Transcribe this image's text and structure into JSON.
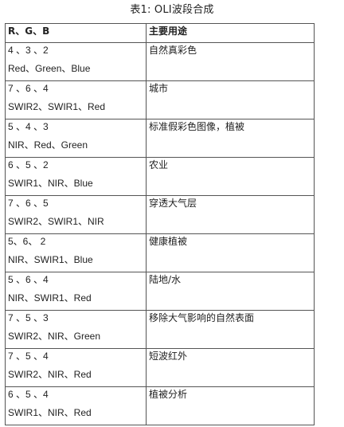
{
  "caption": "表1: OLI波段合成",
  "table": {
    "headers": [
      "R、G、B",
      "主要用途"
    ],
    "rows": [
      {
        "bands": "4 、3 、2",
        "names": "Red、Green、Blue",
        "use": "自然真彩色"
      },
      {
        "bands": "7 、6 、4",
        "names": "SWIR2、SWIR1、Red",
        "use": "城市"
      },
      {
        "bands": "5 、4 、3",
        "names": "NIR、Red、Green",
        "use": "标准假彩色图像，植被"
      },
      {
        "bands": "6 、5 、2",
        "names": "SWIR1、NIR、Blue",
        "use": "农业"
      },
      {
        "bands": "7 、6 、5",
        "names": "SWIR2、SWIR1、NIR",
        "use": "穿透大气层"
      },
      {
        "bands": "5、6、 2",
        "names": "NIR、SWIR1、Blue",
        "use": "健康植被"
      },
      {
        "bands": "5 、6 、4",
        "names": "NIR、SWIR1、Red",
        "use": "陆地/水"
      },
      {
        "bands": "7 、5 、3",
        "names": "SWIR2、NIR、Green",
        "use": "移除大气影响的自然表面"
      },
      {
        "bands": "7 、5 、4",
        "names": "SWIR2、NIR、Red",
        "use": "短波红外"
      },
      {
        "bands": "6 、5 、4",
        "names": "SWIR1、NIR、Red",
        "use": "植被分析"
      }
    ]
  }
}
